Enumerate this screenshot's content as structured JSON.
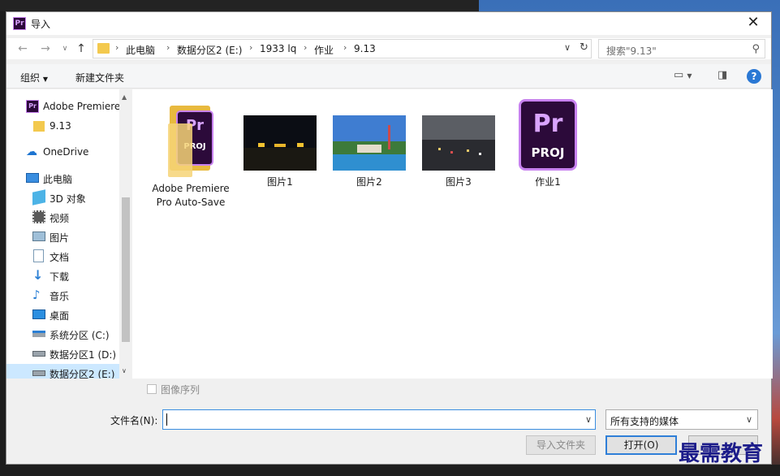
{
  "window": {
    "title": "导入",
    "close": "✕"
  },
  "address": {
    "crumbs": [
      "此电脑",
      "数据分区2 (E:)",
      "1933 lq",
      "作业",
      "9.13"
    ],
    "search_placeholder": "搜索\"9.13\""
  },
  "toolbar": {
    "organize": "组织",
    "new_folder": "新建文件夹",
    "help": "?"
  },
  "nav": {
    "items": [
      {
        "label": "Adobe Premiere",
        "icon": "premiere-icon"
      },
      {
        "label": "9.13",
        "icon": "folder-icon"
      },
      {
        "label": "OneDrive",
        "icon": "onedrive-icon"
      },
      {
        "label": "此电脑",
        "icon": "pc-icon"
      },
      {
        "label": "3D 对象",
        "icon": "3d-objects-icon"
      },
      {
        "label": "视频",
        "icon": "video-icon"
      },
      {
        "label": "图片",
        "icon": "pictures-icon"
      },
      {
        "label": "文档",
        "icon": "documents-icon"
      },
      {
        "label": "下载",
        "icon": "download-icon"
      },
      {
        "label": "音乐",
        "icon": "music-icon"
      },
      {
        "label": "桌面",
        "icon": "desktop-icon"
      },
      {
        "label": "系统分区 (C:)",
        "icon": "drive-c-icon"
      },
      {
        "label": "数据分区1 (D:)",
        "icon": "drive-icon"
      },
      {
        "label": "数据分区2 (E:)",
        "icon": "drive-icon",
        "selected": true
      }
    ]
  },
  "files": [
    {
      "label": "Adobe Premiere Pro Auto-Save",
      "type": "folder"
    },
    {
      "label": "图片1",
      "type": "image"
    },
    {
      "label": "图片2",
      "type": "image"
    },
    {
      "label": "图片3",
      "type": "image"
    },
    {
      "label": "作业1",
      "type": "project",
      "badge": "Pr",
      "tag": "PROJ"
    }
  ],
  "folder_icon_badge": {
    "badge": "Pr",
    "tag": "PROJ"
  },
  "bottom": {
    "image_sequence": "图像序列",
    "filename_label": "文件名(N):",
    "filename_value": "",
    "file_type": "所有支持的媒体",
    "import_folder": "导入文件夹",
    "open": "打开(O)"
  },
  "watermark": "最需教育"
}
